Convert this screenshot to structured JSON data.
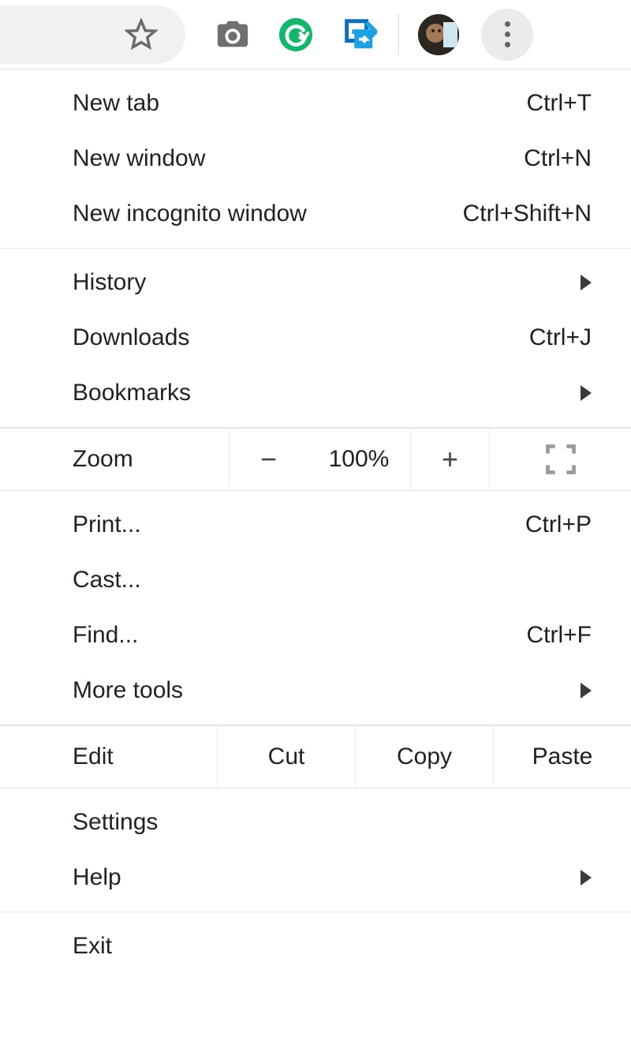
{
  "toolbar": {
    "icons": {
      "star": "star-icon",
      "camera": "camera-icon",
      "grammarly": "grammarly-icon",
      "export": "export-icon",
      "avatar": "profile-avatar",
      "more": "more-icon"
    }
  },
  "menu": {
    "section1": [
      {
        "label": "New tab",
        "shortcut": "Ctrl+T"
      },
      {
        "label": "New window",
        "shortcut": "Ctrl+N"
      },
      {
        "label": "New incognito window",
        "shortcut": "Ctrl+Shift+N"
      }
    ],
    "section2": [
      {
        "label": "History",
        "submenu": true
      },
      {
        "label": "Downloads",
        "shortcut": "Ctrl+J"
      },
      {
        "label": "Bookmarks",
        "submenu": true
      }
    ],
    "zoom": {
      "label": "Zoom",
      "minus": "−",
      "value": "100%",
      "plus": "+"
    },
    "section3": [
      {
        "label": "Print...",
        "shortcut": "Ctrl+P"
      },
      {
        "label": "Cast..."
      },
      {
        "label": "Find...",
        "shortcut": "Ctrl+F"
      },
      {
        "label": "More tools",
        "submenu": true
      }
    ],
    "edit": {
      "label": "Edit",
      "cut": "Cut",
      "copy": "Copy",
      "paste": "Paste"
    },
    "section4": [
      {
        "label": "Settings"
      },
      {
        "label": "Help",
        "submenu": true
      }
    ],
    "section5": [
      {
        "label": "Exit"
      }
    ]
  }
}
